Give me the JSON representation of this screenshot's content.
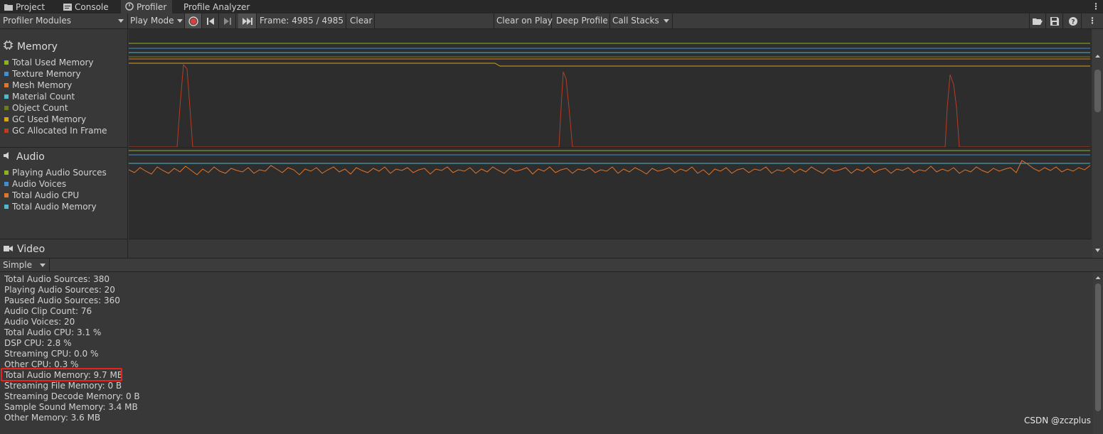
{
  "tabs": [
    {
      "label": "Project",
      "icon": "folder-icon"
    },
    {
      "label": "Console",
      "icon": "console-icon"
    },
    {
      "label": "Profiler",
      "icon": "profiler-icon"
    },
    {
      "label": "Profile Analyzer",
      "icon": ""
    }
  ],
  "toolbar": {
    "modules_label": "Profiler Modules",
    "play_mode_label": "Play Mode",
    "frame_label": "Frame: 4985 / 4985",
    "clear_label": "Clear",
    "clear_on_play_label": "Clear on Play",
    "deep_profile_label": "Deep Profile",
    "call_stacks_label": "Call Stacks"
  },
  "modules": {
    "memory": {
      "title": "Memory",
      "items": [
        {
          "label": "Total Used Memory",
          "color": "#8cb326"
        },
        {
          "label": "Texture Memory",
          "color": "#3f8ed1"
        },
        {
          "label": "Mesh Memory",
          "color": "#e0752b"
        },
        {
          "label": "Material Count",
          "color": "#4fb8c9"
        },
        {
          "label": "Object Count",
          "color": "#6b7f15"
        },
        {
          "label": "GC Used Memory",
          "color": "#d6a417"
        },
        {
          "label": "GC Allocated In Frame",
          "color": "#b83d22"
        }
      ]
    },
    "audio": {
      "title": "Audio",
      "items": [
        {
          "label": "Playing Audio Sources",
          "color": "#8cb326"
        },
        {
          "label": "Audio Voices",
          "color": "#3f8ed1"
        },
        {
          "label": "Total Audio CPU",
          "color": "#e0752b"
        },
        {
          "label": "Total Audio Memory",
          "color": "#4fb8c9"
        }
      ]
    },
    "video": {
      "title": "Video"
    }
  },
  "details": {
    "view_mode": "Simple",
    "lines": [
      "Total Audio Sources: 380",
      "Playing Audio Sources: 20",
      "Paused Audio Sources: 360",
      "Audio Clip Count: 76",
      "Audio Voices: 20",
      "Total Audio CPU: 3.1 %",
      "DSP CPU: 2.8 %",
      "Streaming CPU: 0.0 %",
      "Other CPU: 0.3 %",
      "Total Audio Memory: 9.7 MB",
      "Streaming File Memory: 0 B",
      "Streaming Decode Memory: 0 B",
      "Sample Sound Memory: 3.4 MB",
      "Other Memory: 3.6 MB"
    ]
  },
  "watermark": "CSDN @zczplus"
}
